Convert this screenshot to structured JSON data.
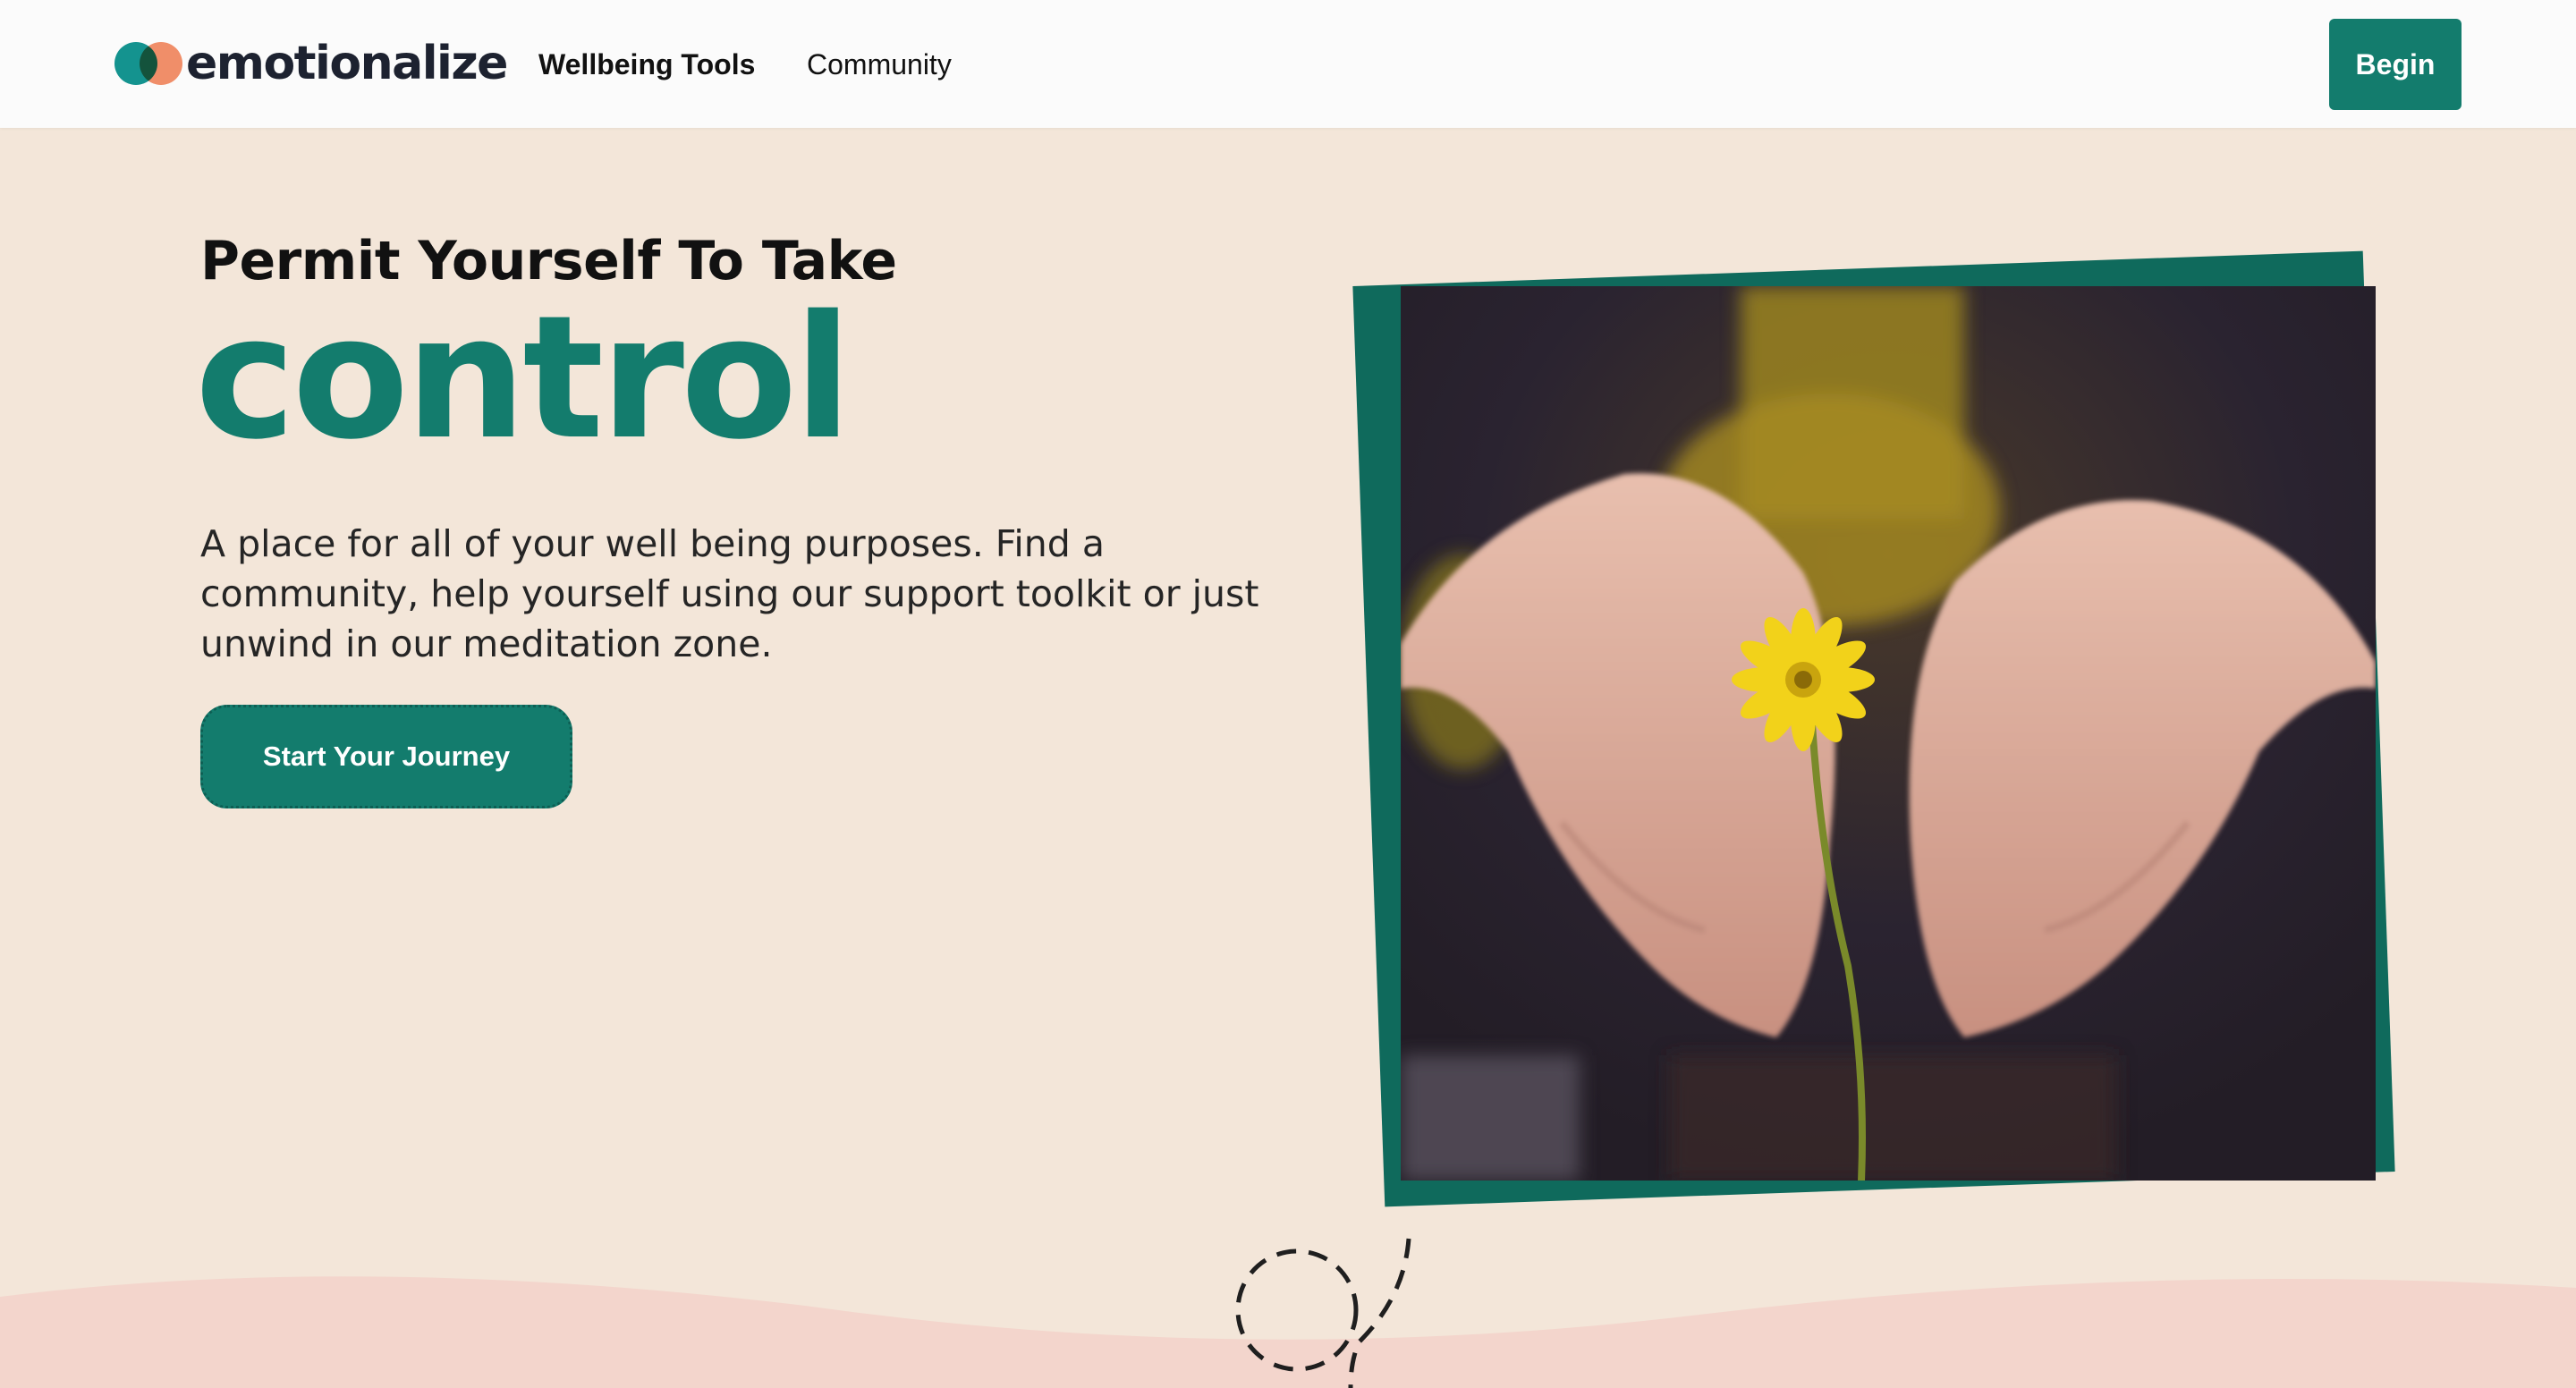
{
  "header": {
    "logo_text": "emotionalize",
    "nav": [
      {
        "label": "Wellbeing Tools"
      },
      {
        "label": "Community"
      }
    ],
    "begin_label": "Begin"
  },
  "hero": {
    "subtitle": "Permit Yourself To Take",
    "highlight": "control",
    "description": "A place for all of your well being purposes. Find a community, help yourself using our support toolkit or just unwind in our meditation zone.",
    "cta_label": "Start Your Journey"
  },
  "colors": {
    "brand_teal": "#137c6d",
    "logo_orange": "#f4875e",
    "background": "#f3e6d9",
    "wave_pink": "#f3d5cc"
  },
  "icons": [
    "logo-mark-icon",
    "dashed-loop-doodle-icon"
  ]
}
